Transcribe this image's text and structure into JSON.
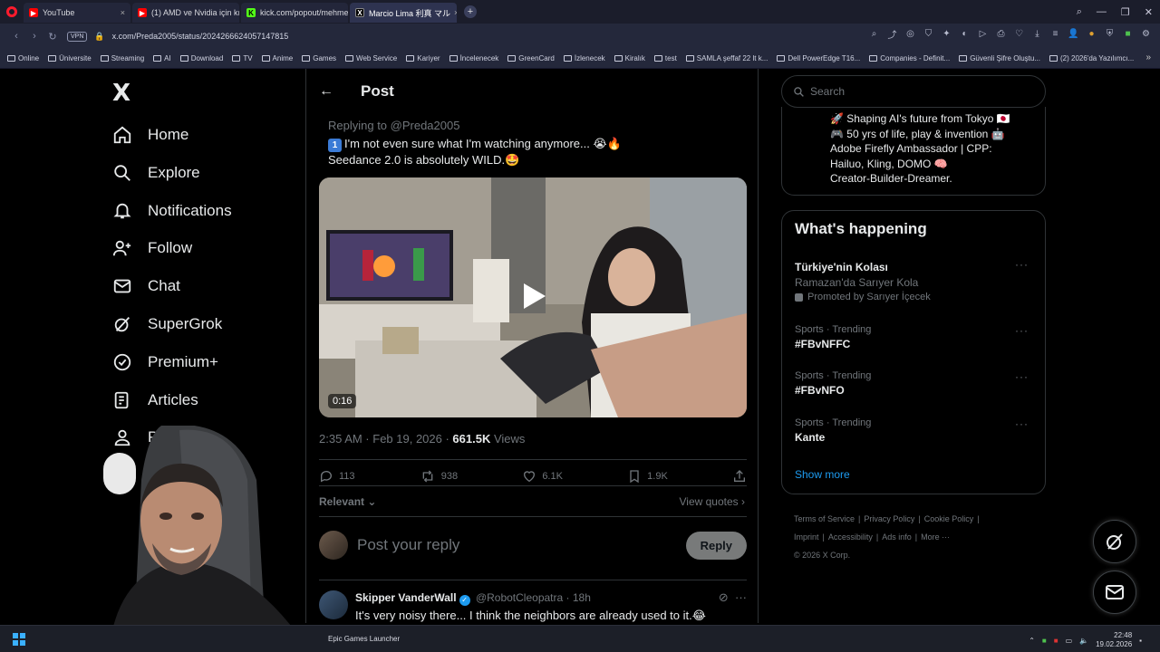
{
  "browser": {
    "tabs": [
      {
        "label": "YouTube",
        "color": "#ff0000",
        "active": false
      },
      {
        "label": "(1) AMD ve Nvidia için kır",
        "color": "#ff0000",
        "active": false
      },
      {
        "label": "kick.com/popout/mehme",
        "color": "#53fc18",
        "active": false
      },
      {
        "label": "Marcio Lima 利真 マル",
        "color": "#ffffff",
        "active": true
      }
    ],
    "new_tab": "+",
    "vpn_label": "VPN",
    "url": "x.com/Preda2005/status/2024266624057147815",
    "bookmarks": [
      "Online",
      "Üniversite",
      "Streaming",
      "AI",
      "Download",
      "TV",
      "Anime",
      "Games",
      "Web Service",
      "Kariyer",
      "İncelenecek",
      "GreenCard",
      "İzlenecek",
      "Kiralık",
      "test",
      "SAMLA şeffaf 22 lt k...",
      "Dell PowerEdge T16...",
      "Companies - Definit...",
      "Güvenli Şifre Oluştu...",
      "(2) 2026'da Yazılımcı..."
    ]
  },
  "nav": {
    "logo": "X",
    "items": [
      {
        "label": "Home",
        "icon": "home-icon"
      },
      {
        "label": "Explore",
        "icon": "search-icon"
      },
      {
        "label": "Notifications",
        "icon": "bell-icon"
      },
      {
        "label": "Follow",
        "icon": "person-add-icon"
      },
      {
        "label": "Chat",
        "icon": "mail-icon"
      },
      {
        "label": "SuperGrok",
        "icon": "grok-icon"
      },
      {
        "label": "Premium+",
        "icon": "verified-icon"
      },
      {
        "label": "Articles",
        "icon": "article-icon"
      },
      {
        "label": "Pro",
        "icon": "profile-icon"
      }
    ]
  },
  "post": {
    "header_title": "Post",
    "replying_to": "Replying to @Preda2005",
    "badge": "1",
    "text_line1": "I'm not even sure what I'm watching anymore... 😭🔥",
    "text_line2": "Seedance 2.0 is absolutely WILD.🤩",
    "video_duration": "0:16",
    "timestamp": "2:35 AM · Feb 19, 2026 · ",
    "views_count": "661.5K",
    "views_label": " Views",
    "stats": {
      "replies": "113",
      "reposts": "938",
      "likes": "6.1K",
      "bookmarks": "1.9K"
    },
    "sort_label": "Relevant",
    "view_quotes": "View quotes",
    "reply_placeholder": "Post your reply",
    "reply_button": "Reply"
  },
  "comment": {
    "name": "Skipper VanderWall",
    "handle": "@RobotCleopatra",
    "time": "· 18h",
    "text": "It's very noisy there... I think the neighbors are already used to it.😂"
  },
  "sidebar": {
    "search_placeholder": "Search",
    "bio_lines": [
      "🚀 Shaping AI's future from Tokyo 🇯🇵",
      "🎮 50 yrs of life, play & invention 🤖",
      "Adobe Firefly Ambassador | CPP:",
      "Hailuo, Kling, DOMO 🧠",
      "Creator-Builder-Dreamer."
    ],
    "happening_title": "What's happening",
    "trends": [
      {
        "category": "",
        "title": "Türkiye'nin Kolası",
        "subtitle": "Ramazan'da Sarıyer Kola",
        "promo": "Promoted by Sarıyer İçecek"
      },
      {
        "category": "Sports · Trending",
        "title": "#FBvNFFC",
        "subtitle": "",
        "promo": ""
      },
      {
        "category": "Sports · Trending",
        "title": "#FBvNFO",
        "subtitle": "",
        "promo": ""
      },
      {
        "category": "Sports · Trending",
        "title": "Kante",
        "subtitle": "",
        "promo": ""
      }
    ],
    "show_more": "Show more",
    "footer_line1": [
      "Terms of Service",
      "|",
      "Privacy Policy",
      "|",
      "Cookie Policy",
      "|"
    ],
    "footer_line2": [
      "Imprint",
      "|",
      "Accessibility",
      "|",
      "Ads info",
      "|",
      "More ···"
    ],
    "copyright": "© 2026 X Corp."
  },
  "taskbar": {
    "app": "Epic Games Launcher",
    "time": "22:48",
    "date": "19.02.2026"
  },
  "colors": {
    "accent": "#1d9bf0",
    "text": "#e7e9ea",
    "muted": "#71767b",
    "border": "#2f3336"
  }
}
